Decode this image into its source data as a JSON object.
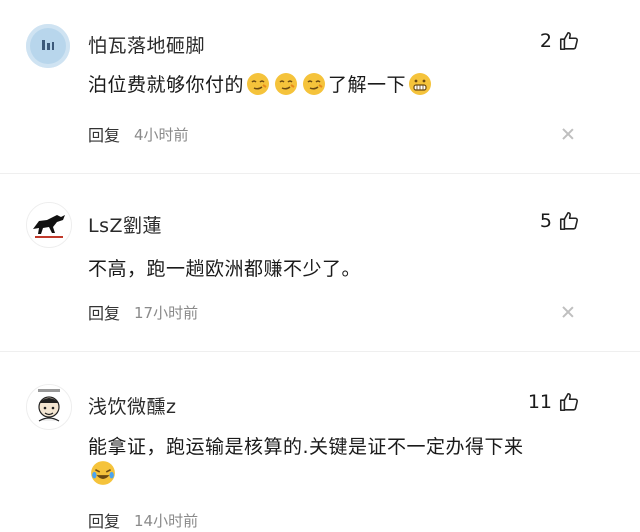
{
  "comments": [
    {
      "username": "怕瓦落地砸脚",
      "likes": "2",
      "text_before": "泊位费就够你付的",
      "text_after": "了解一下",
      "reply_label": "回复",
      "time": "4小时前"
    },
    {
      "username": "LsZ劉蓮",
      "likes": "5",
      "text": "不高，跑一趟欧洲都赚不少了。",
      "reply_label": "回复",
      "time": "17小时前"
    },
    {
      "username": "浅饮微醺z",
      "likes": "11",
      "text": "能拿证，跑运输是核算的.关键是证不一定办得下来",
      "reply_label": "回复",
      "time": "14小时前"
    }
  ],
  "colors": {
    "accent_emoji": "#f5c33b",
    "muted_text": "#8a8a8a"
  }
}
